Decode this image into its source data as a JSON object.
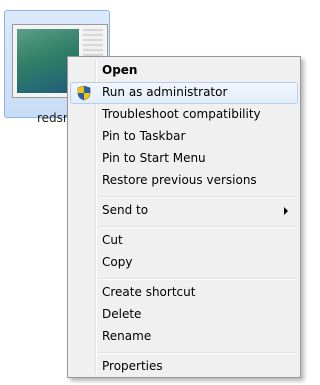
{
  "desktop_icon": {
    "label": "redsn0"
  },
  "context_menu": {
    "groups": [
      {
        "items": [
          {
            "label": "Open",
            "bold": true
          },
          {
            "label": "Run as administrator",
            "icon": "uac-shield-icon",
            "highlighted": true
          },
          {
            "label": "Troubleshoot compatibility"
          },
          {
            "label": "Pin to Taskbar"
          },
          {
            "label": "Pin to Start Menu"
          },
          {
            "label": "Restore previous versions"
          }
        ]
      },
      {
        "items": [
          {
            "label": "Send to",
            "submenu": true
          }
        ]
      },
      {
        "items": [
          {
            "label": "Cut"
          },
          {
            "label": "Copy"
          }
        ]
      },
      {
        "items": [
          {
            "label": "Create shortcut"
          },
          {
            "label": "Delete"
          },
          {
            "label": "Rename"
          }
        ]
      },
      {
        "items": [
          {
            "label": "Properties"
          }
        ]
      }
    ]
  },
  "colors": {
    "menu_background": "#f0f0f0",
    "menu_border": "#979797",
    "highlight_border": "#b3cdee",
    "icon_selection": "#c8ddf6"
  }
}
